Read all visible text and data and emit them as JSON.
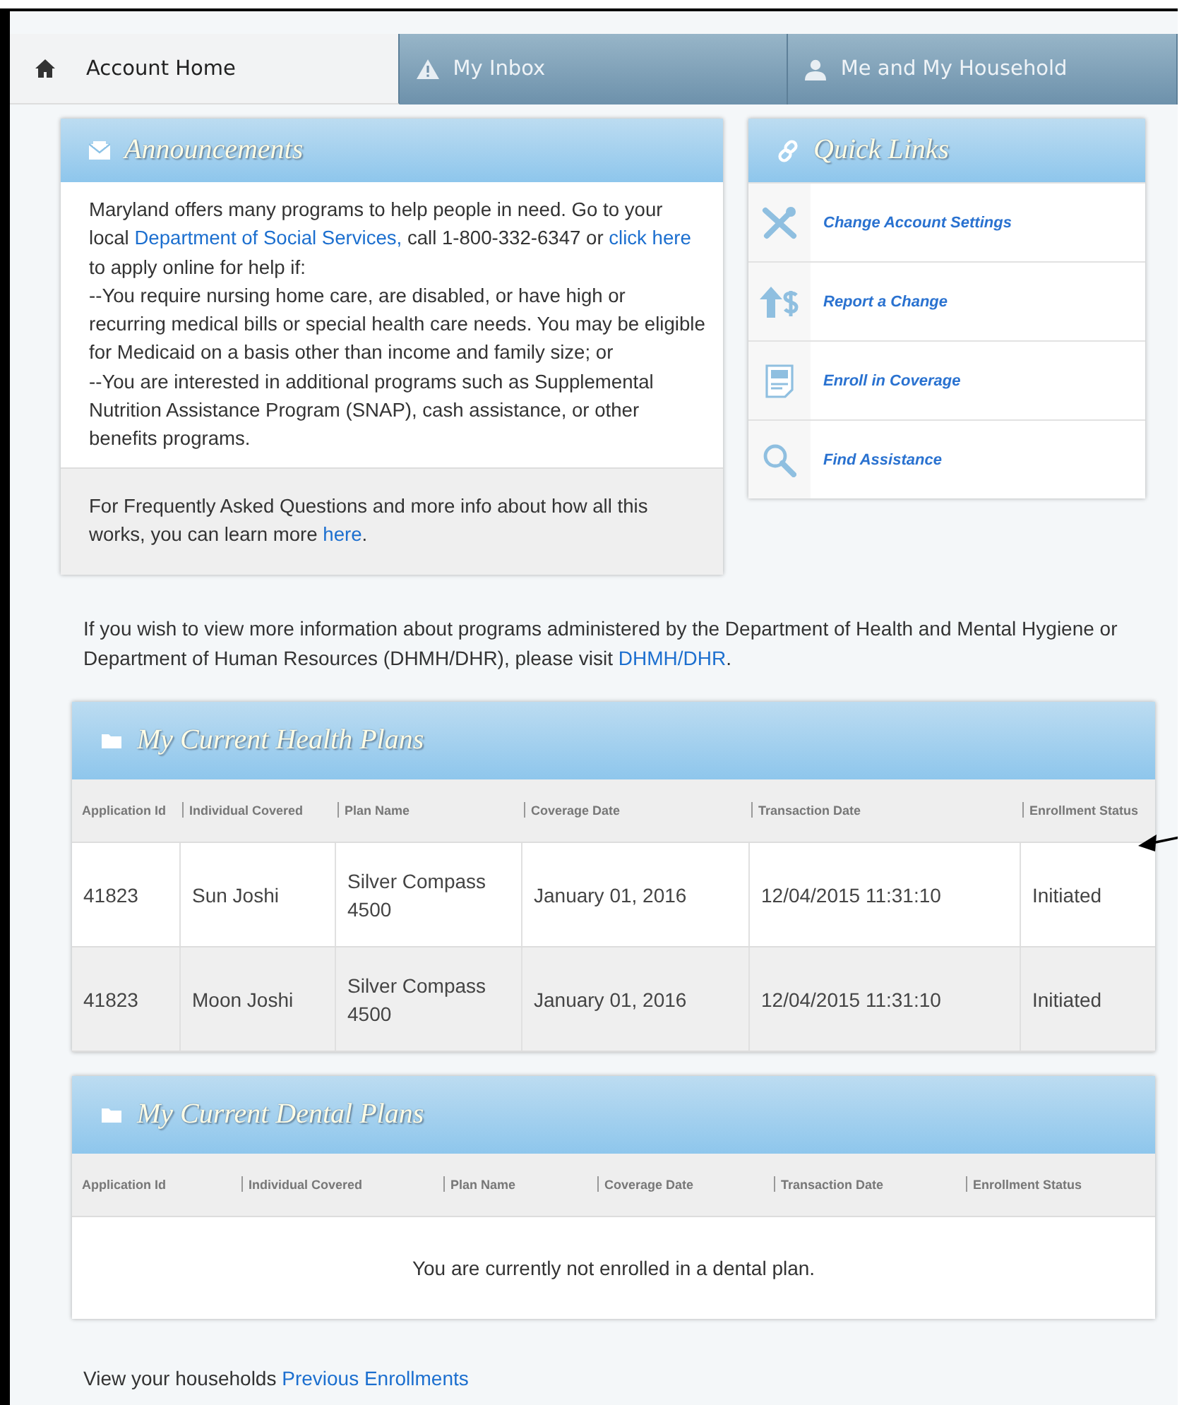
{
  "tabs": [
    {
      "label": "Account Home",
      "kind": "home",
      "selected": true
    },
    {
      "label": "My Inbox",
      "kind": "warning",
      "selected": false
    },
    {
      "label": "Me and My Household",
      "kind": "person",
      "selected": false
    }
  ],
  "announcements": {
    "title": "Announcements",
    "paragraphs": [
      [
        {
          "kind": "text",
          "text": "Maryland offers many programs to help people in need. Go to your local "
        },
        {
          "kind": "link",
          "text": "Department of Social Services,"
        },
        {
          "kind": "text",
          "text": " call 1-800-332-6347 or "
        },
        {
          "kind": "link",
          "text": "click here"
        },
        {
          "kind": "text",
          "text": " to apply online for help if:"
        }
      ],
      [
        {
          "kind": "text",
          "text": "--You require nursing home care, are disabled, or have high or recurring medical bills or special health care needs. You may be eligible for Medicaid on a basis other than income and family size; or"
        }
      ],
      [
        {
          "kind": "text",
          "text": "--You are interested in additional programs such as Supplemental Nutrition Assistance Program (SNAP), cash assistance, or other benefits programs."
        }
      ]
    ],
    "footer": [
      {
        "kind": "text",
        "text": "For Frequently Asked Questions and more info about how all this works, you can learn more "
      },
      {
        "kind": "link",
        "text": "here"
      },
      {
        "kind": "text",
        "text": "."
      }
    ]
  },
  "quick_links": {
    "title": "Quick Links",
    "items": [
      {
        "label": "Change Account Settings",
        "kind": "tools"
      },
      {
        "label": "Report a Change",
        "kind": "money"
      },
      {
        "label": "Enroll in Coverage",
        "kind": "document"
      },
      {
        "label": "Find Assistance",
        "kind": "search"
      }
    ]
  },
  "info": [
    {
      "kind": "text",
      "text": "If you wish to view more information about programs administered by the Department of Health and Mental Hygiene or Department of Human Resources (DHMH/DHR), please visit "
    },
    {
      "kind": "link",
      "text": "DHMH/DHR"
    },
    {
      "kind": "text",
      "text": "."
    }
  ],
  "health_plans": {
    "title": "My Current Health Plans",
    "columns": [
      "Application Id",
      "Individual Covered",
      "Plan Name",
      "Coverage Date",
      "Transaction Date",
      "Enrollment Status"
    ],
    "rows": [
      [
        "41823",
        "Sun  Joshi",
        "Silver Compass 4500",
        "January 01, 2016",
        "12/04/2015 11:31:10",
        "Initiated"
      ],
      [
        "41823",
        "Moon  Joshi",
        "Silver Compass 4500",
        "January 01, 2016",
        "12/04/2015 11:31:10",
        "Initiated"
      ]
    ]
  },
  "dental_plans": {
    "title": "My Current Dental Plans",
    "columns": [
      "Application Id",
      "Individual Covered",
      "Plan Name",
      "Coverage Date",
      "Transaction Date",
      "Enrollment Status"
    ],
    "empty_message": "You are currently not enrolled in a dental plan."
  },
  "footer": [
    {
      "kind": "text",
      "text": "View your households "
    },
    {
      "kind": "link",
      "text": "Previous Enrollments"
    }
  ]
}
